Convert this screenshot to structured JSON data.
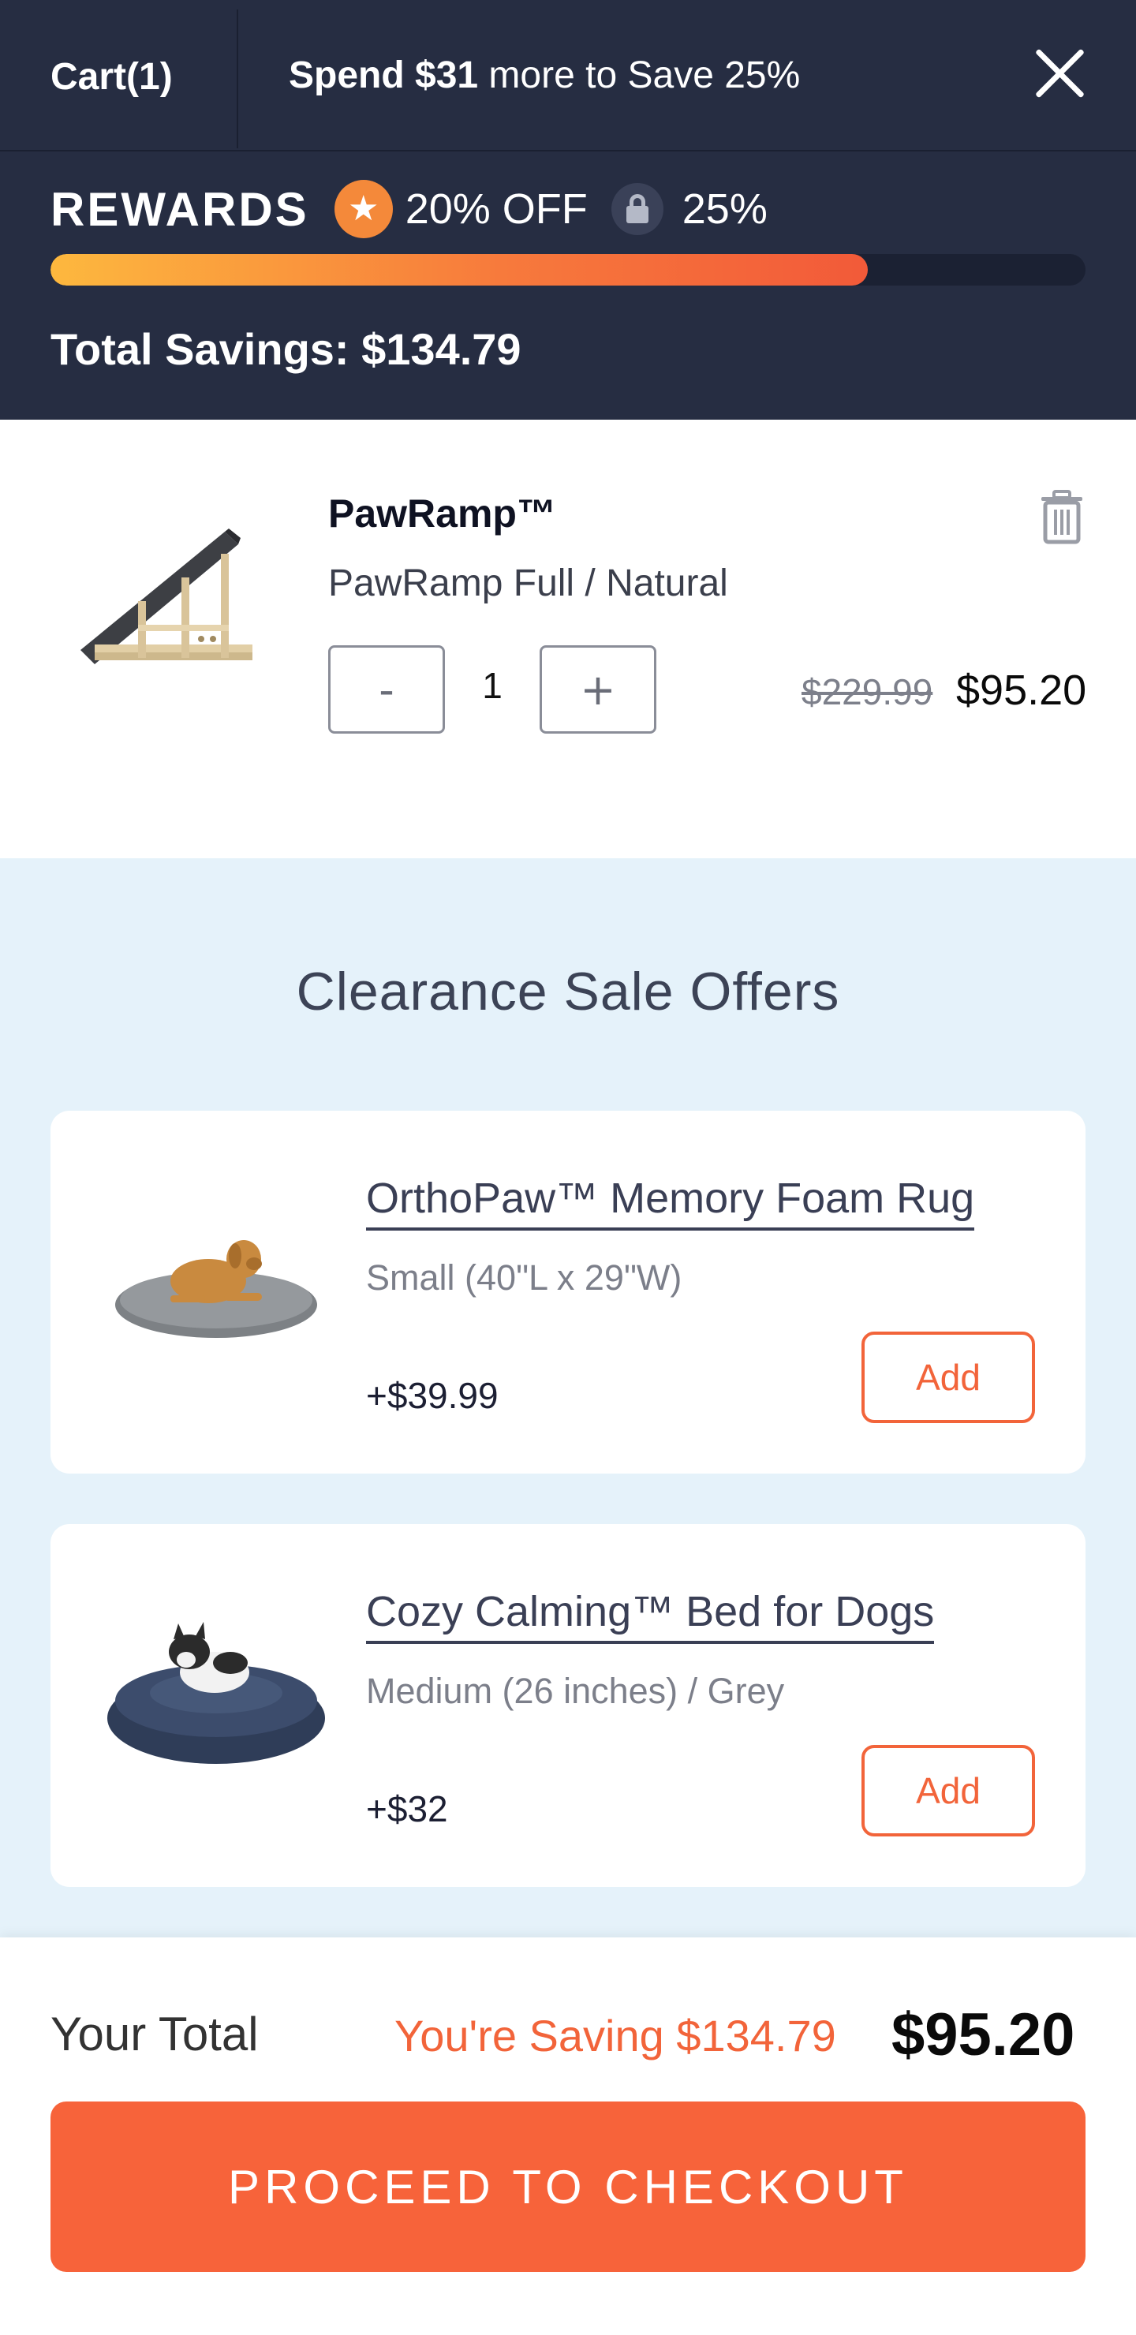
{
  "header": {
    "cart_label": "Cart(1)",
    "spend_amount": "Spend $31",
    "spend_rest": " more to Save 25%",
    "close_icon": "close-icon"
  },
  "rewards": {
    "title": "REWARDS",
    "tier1_icon": "star-icon",
    "tier1_label": "20% OFF",
    "tier2_icon": "lock-icon",
    "tier2_label": "25%",
    "progress_fraction": 0.79,
    "total_savings": "Total Savings: $134.79"
  },
  "cart_item": {
    "name": "PawRamp™",
    "variant": "PawRamp Full / Natural",
    "qty_minus": "-",
    "quantity": "1",
    "qty_plus": "+",
    "original_price": "$229.99",
    "price": "$95.20",
    "delete_icon": "trash-icon"
  },
  "offers": {
    "title": "Clearance Sale Offers",
    "items": [
      {
        "name": "OrthoPaw™ Memory Foam Rug",
        "variant": "Small (40\"L x 29\"W)",
        "price": "+$39.99",
        "button": "Add"
      },
      {
        "name": "Cozy Calming™ Bed for Dogs",
        "variant": "Medium (26 inches) / Grey",
        "price": "+$32",
        "button": "Add"
      }
    ]
  },
  "footer": {
    "your_total_label": "Your Total",
    "saving_text": "You're Saving $134.79",
    "total": "$95.20",
    "checkout_label": "PROCEED TO CHECKOUT"
  },
  "colors": {
    "header_bg": "#262d42",
    "accent": "#f7633a",
    "offers_bg": "#e5f2fa"
  }
}
